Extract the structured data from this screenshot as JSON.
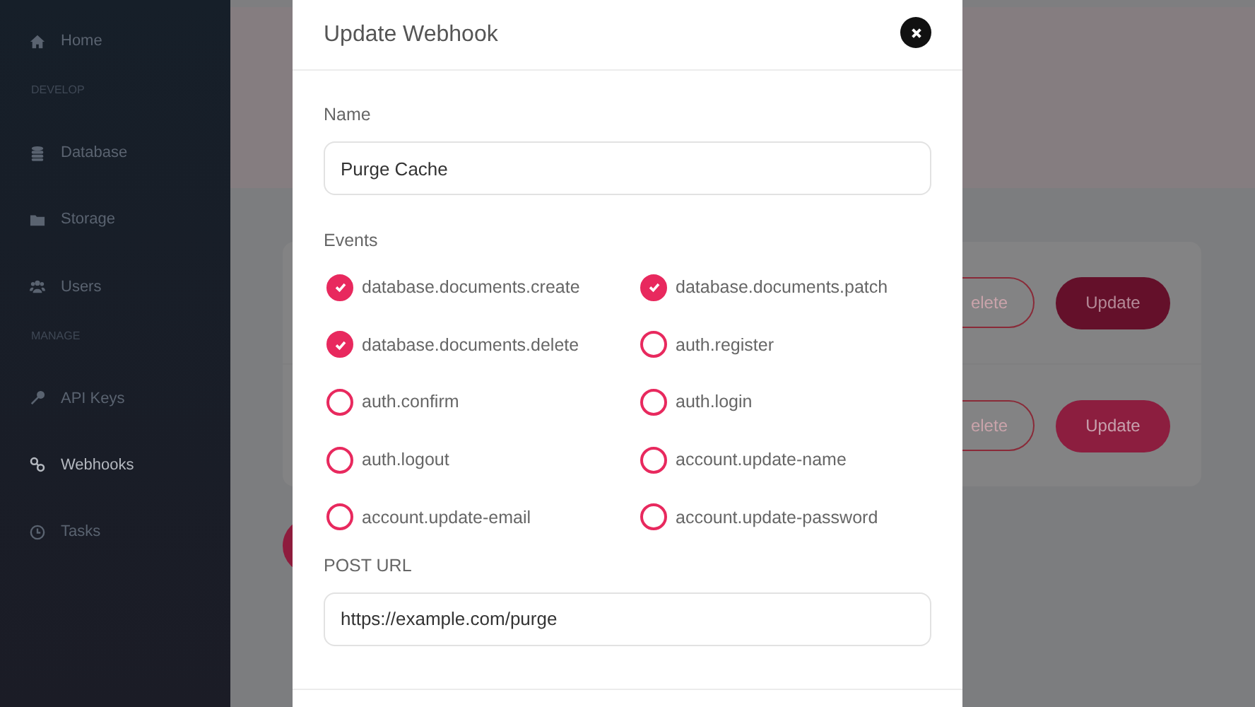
{
  "sidebar": {
    "items": [
      {
        "kind": "link",
        "label": "Home",
        "selected": false
      },
      {
        "kind": "section",
        "label": "DEVELOP"
      },
      {
        "kind": "link",
        "label": "Database",
        "selected": false
      },
      {
        "kind": "link",
        "label": "Storage",
        "selected": false
      },
      {
        "kind": "link",
        "label": "Users",
        "selected": false
      },
      {
        "kind": "section",
        "label": "MANAGE"
      },
      {
        "kind": "link",
        "label": "API Keys",
        "selected": false
      },
      {
        "kind": "link",
        "label": "Webhooks",
        "selected": true
      },
      {
        "kind": "link",
        "label": "Tasks",
        "selected": false
      }
    ]
  },
  "webhook_list": {
    "rows": [
      {
        "delete_button": "elete",
        "update_button": "Update",
        "hovered": true
      },
      {
        "delete_button": "elete",
        "update_button": "Update",
        "hovered": false
      }
    ]
  },
  "modal": {
    "title": "Update Webhook",
    "name_label": "Name",
    "name_value": "Purge Cache",
    "events_label": "Events",
    "events": [
      {
        "label": "database.documents.create",
        "checked": true
      },
      {
        "label": "database.documents.patch",
        "checked": true
      },
      {
        "label": "database.documents.delete",
        "checked": true
      },
      {
        "label": "auth.register",
        "checked": false
      },
      {
        "label": "auth.confirm",
        "checked": false
      },
      {
        "label": "auth.login",
        "checked": false
      },
      {
        "label": "auth.logout",
        "checked": false
      },
      {
        "label": "account.update-name",
        "checked": false
      },
      {
        "label": "account.update-email",
        "checked": false
      },
      {
        "label": "account.update-password",
        "checked": false
      }
    ],
    "url_label": "POST URL",
    "url_value": "https://example.com/purge"
  }
}
